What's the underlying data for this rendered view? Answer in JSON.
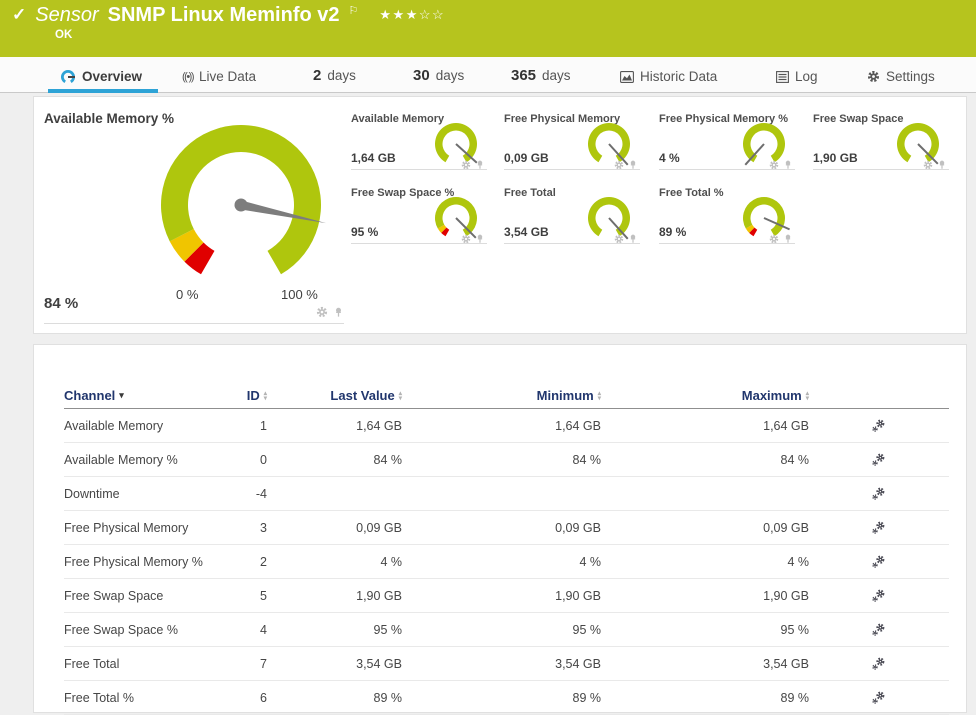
{
  "colors": {
    "header_green": "#b6c41e",
    "gauge_green": "#afc60d",
    "gauge_yellow": "#f0c500",
    "gauge_red": "#e00000",
    "needle_gray": "#7d7d7d",
    "accent_blue": "#2ea3d6",
    "table_header_navy": "#21366d"
  },
  "header": {
    "check": "✓",
    "kind": "Sensor",
    "title": "SNMP Linux Meminfo v2",
    "flag": "⚐",
    "stars": "★★★☆☆",
    "status": "OK"
  },
  "tabs": [
    {
      "label": "Overview",
      "active": true
    },
    {
      "label": "Live Data"
    },
    {
      "num": "2",
      "label": "days"
    },
    {
      "num": "30",
      "label": "days"
    },
    {
      "num": "365",
      "label": "days"
    },
    {
      "label": "Historic Data"
    },
    {
      "label": "Log"
    },
    {
      "label": "Settings"
    }
  ],
  "overview": {
    "main_gauge": {
      "title": "Available Memory %",
      "value": "84 %",
      "min_label": "0 %",
      "max_label": "100 %",
      "percent": 84,
      "segments": [
        {
          "to": 5,
          "color": "#e00000"
        },
        {
          "to": 11,
          "color": "#f0c500"
        },
        {
          "to": 100,
          "color": "#afc60d"
        }
      ]
    },
    "mini_gauges": [
      {
        "title": "Available Memory",
        "value": "1,64 GB",
        "percent": 94,
        "segments": [
          {
            "to": 100,
            "color": "#afc60d"
          }
        ]
      },
      {
        "title": "Free Physical Memory",
        "value": "0,09 GB",
        "percent": 96,
        "segments": [
          {
            "to": 100,
            "color": "#afc60d"
          }
        ]
      },
      {
        "title": "Free Physical Memory %",
        "value": "4 %",
        "percent": 4,
        "segments": [
          {
            "to": 100,
            "color": "#afc60d"
          }
        ]
      },
      {
        "title": "Free Swap Space",
        "value": "1,90 GB",
        "percent": 95,
        "segments": [
          {
            "to": 100,
            "color": "#afc60d"
          }
        ]
      },
      {
        "title": "Free Swap Space %",
        "value": "95 %",
        "percent": 95,
        "segments": [
          {
            "to": 5,
            "color": "#e00000"
          },
          {
            "to": 10,
            "color": "#f0c500"
          },
          {
            "to": 100,
            "color": "#afc60d"
          }
        ]
      },
      {
        "title": "Free Total",
        "value": "3,54 GB",
        "percent": 96,
        "segments": [
          {
            "to": 100,
            "color": "#afc60d"
          }
        ]
      },
      {
        "title": "Free Total %",
        "value": "89 %",
        "percent": 88,
        "segments": [
          {
            "to": 5,
            "color": "#e00000"
          },
          {
            "to": 10,
            "color": "#f0c500"
          },
          {
            "to": 100,
            "color": "#afc60d"
          }
        ]
      }
    ]
  },
  "table": {
    "columns": {
      "channel": "Channel",
      "id": "ID",
      "last_value": "Last Value",
      "minimum": "Minimum",
      "maximum": "Maximum"
    },
    "rows": [
      {
        "channel": "Available Memory",
        "id": "1",
        "last_value": "1,64 GB",
        "minimum": "1,64 GB",
        "maximum": "1,64 GB"
      },
      {
        "channel": "Available Memory %",
        "id": "0",
        "last_value": "84 %",
        "minimum": "84 %",
        "maximum": "84 %"
      },
      {
        "channel": "Downtime",
        "id": "-4",
        "last_value": "",
        "minimum": "",
        "maximum": ""
      },
      {
        "channel": "Free Physical Memory",
        "id": "3",
        "last_value": "0,09 GB",
        "minimum": "0,09 GB",
        "maximum": "0,09 GB"
      },
      {
        "channel": "Free Physical Memory %",
        "id": "2",
        "last_value": "4 %",
        "minimum": "4 %",
        "maximum": "4 %"
      },
      {
        "channel": "Free Swap Space",
        "id": "5",
        "last_value": "1,90 GB",
        "minimum": "1,90 GB",
        "maximum": "1,90 GB"
      },
      {
        "channel": "Free Swap Space %",
        "id": "4",
        "last_value": "95 %",
        "minimum": "95 %",
        "maximum": "95 %"
      },
      {
        "channel": "Free Total",
        "id": "7",
        "last_value": "3,54 GB",
        "minimum": "3,54 GB",
        "maximum": "3,54 GB"
      },
      {
        "channel": "Free Total %",
        "id": "6",
        "last_value": "89 %",
        "minimum": "89 %",
        "maximum": "89 %"
      }
    ]
  }
}
